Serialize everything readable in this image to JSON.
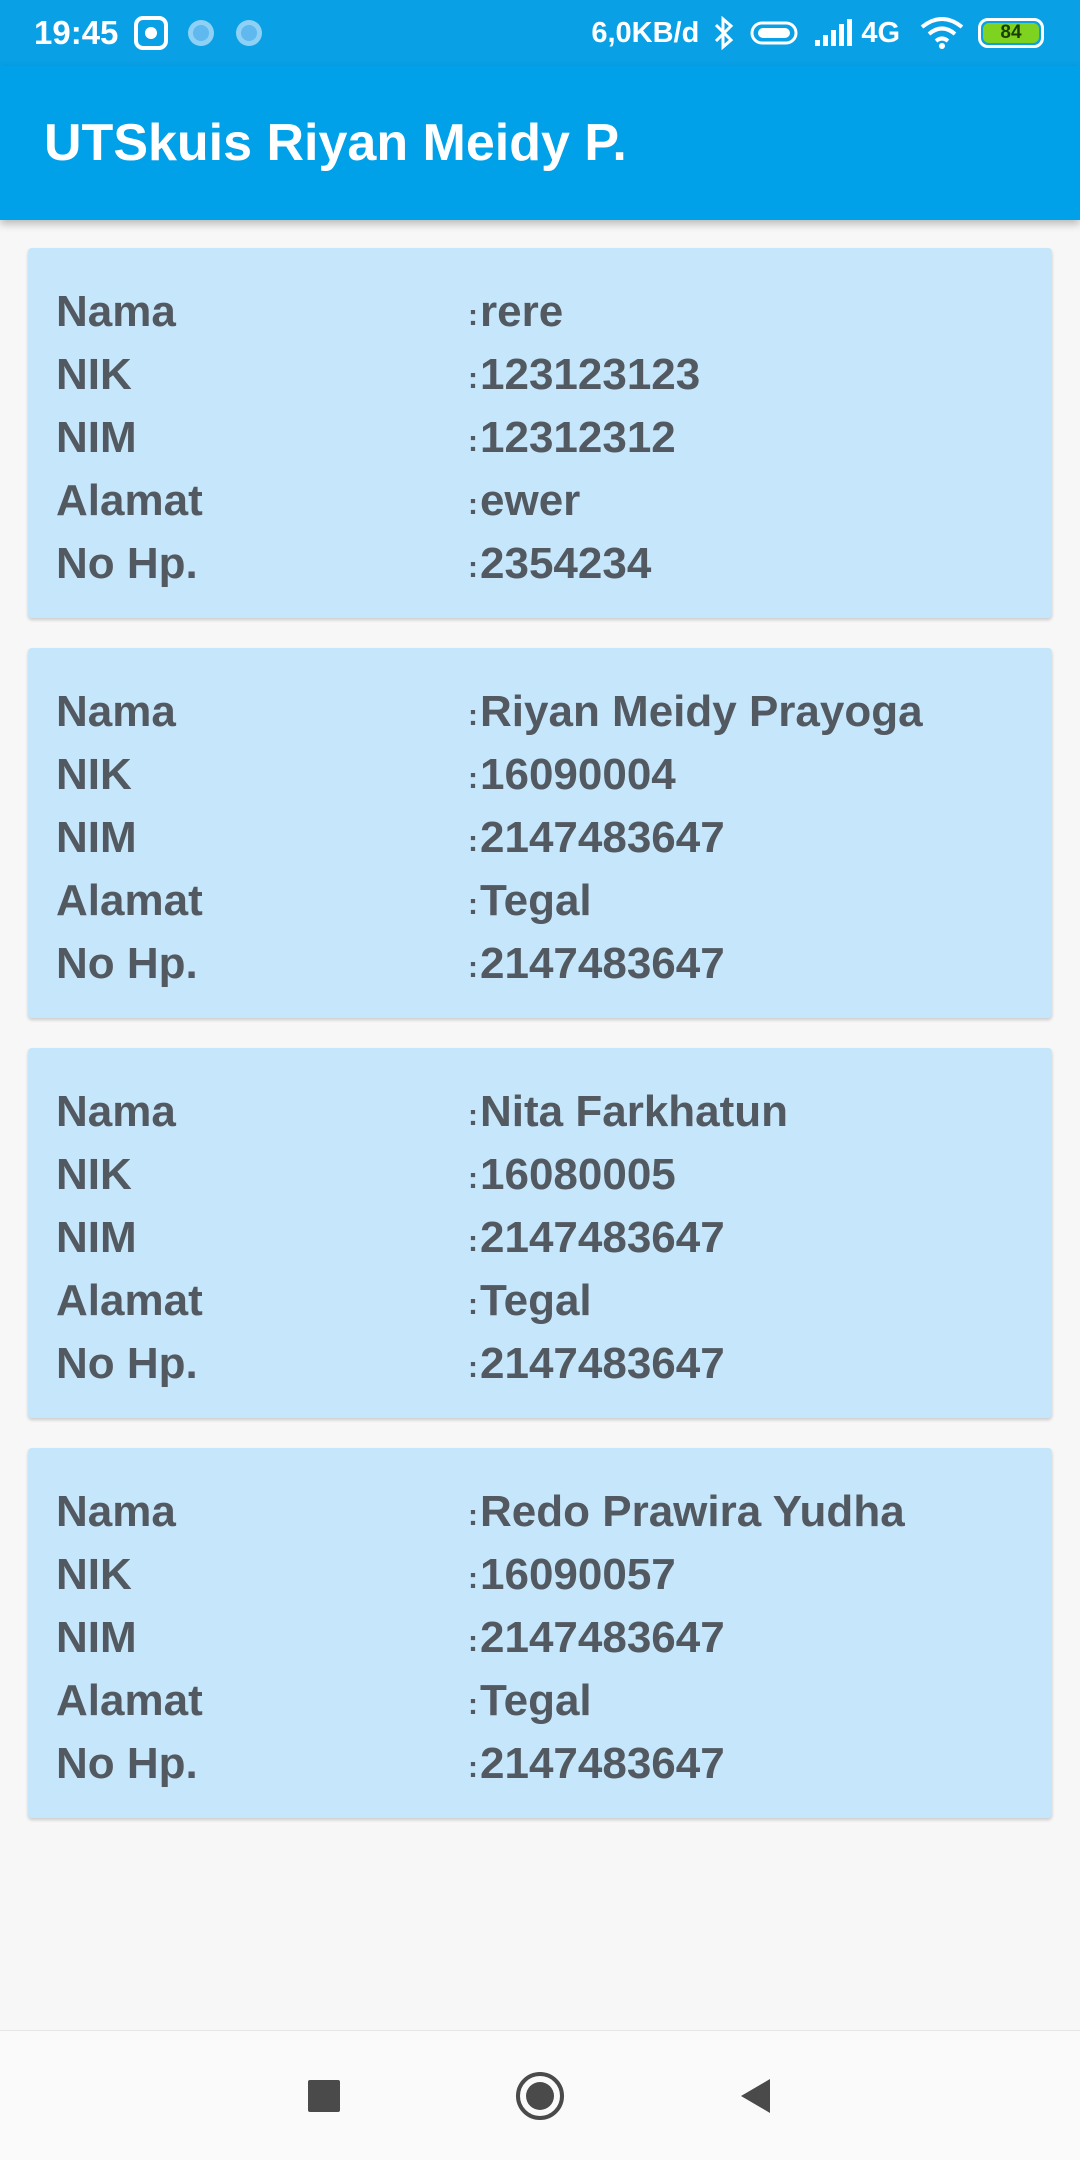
{
  "status_bar": {
    "time": "19:45",
    "speed": "6,0KB/d",
    "network": "4G",
    "battery": "84"
  },
  "app_bar": {
    "title": "UTSkuis Riyan Meidy P."
  },
  "labels": {
    "nama": "Nama",
    "nik": "NIK",
    "nim": "NIM",
    "alamat": "Alamat",
    "nohp": "No Hp.",
    "colon": ":"
  },
  "cards": [
    {
      "nama": "rere",
      "nik": "123123123",
      "nim": "12312312",
      "alamat": "ewer",
      "nohp": "2354234"
    },
    {
      "nama": "Riyan Meidy Prayoga",
      "nik": "16090004",
      "nim": "2147483647",
      "alamat": "Tegal",
      "nohp": "2147483647"
    },
    {
      "nama": "Nita Farkhatun",
      "nik": "16080005",
      "nim": "2147483647",
      "alamat": "Tegal",
      "nohp": "2147483647"
    },
    {
      "nama": "Redo Prawira Yudha",
      "nik": "16090057",
      "nim": "2147483647",
      "alamat": "Tegal",
      "nohp": "2147483647"
    }
  ],
  "colors": {
    "status_bar": "#0aa0e6",
    "app_bar": "#00a1e8",
    "card": "#c6e6fb",
    "text": "#525960"
  },
  "nav": {
    "icons": [
      "recents-square-icon",
      "home-circle-icon",
      "back-triangle-icon"
    ]
  }
}
